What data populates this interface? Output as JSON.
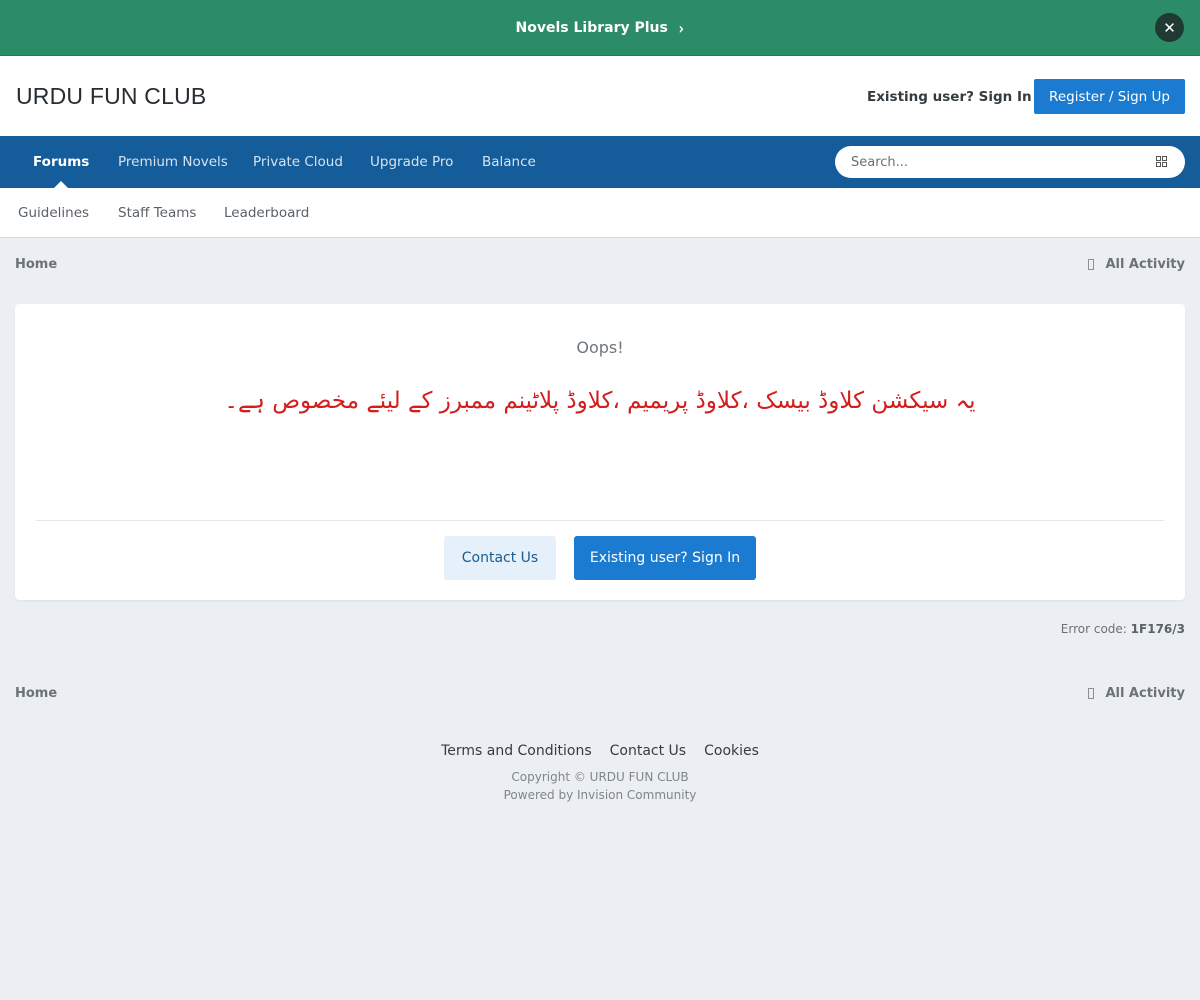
{
  "announcement": {
    "text": "Novels Library Plus",
    "chevron": "›",
    "close": "✕",
    "background": "#2c8c67"
  },
  "header": {
    "site_title": "URDU FUN CLUB",
    "signin_label": "Existing user? Sign In",
    "register_label": "Register / Sign Up",
    "accent": "#1a7bd0"
  },
  "primary_nav": {
    "items": [
      {
        "label": "Forums",
        "active": true
      },
      {
        "label": "Premium Novels"
      },
      {
        "label": "Private Cloud"
      },
      {
        "label": "Upgrade Pro"
      },
      {
        "label": "Balance"
      }
    ],
    "background": "#145c9a",
    "search_placeholder": "Search..."
  },
  "secondary_nav": {
    "items": [
      {
        "label": "Guidelines"
      },
      {
        "label": "Staff Teams"
      },
      {
        "label": "Leaderboard"
      }
    ]
  },
  "breadcrumb": {
    "home": "Home",
    "all_activity": "All Activity"
  },
  "error": {
    "title": "Oops!",
    "message": "یہ سیکشن  کلاوڈ بیسک ،کلاوڈ پریمیم ،کلاوڈ پلاٹینم ممبرز کے لیئے مخصوص ہے۔",
    "contact_label": "Contact Us",
    "signin_label": "Existing user? Sign In",
    "code_label": "Error code:",
    "code_value": "1F176/3",
    "message_color": "#d41d1d"
  },
  "footer": {
    "links": [
      "Terms and Conditions",
      "Contact Us",
      "Cookies"
    ],
    "copyright": "Copyright © URDU FUN CLUB",
    "powered_by": "Powered by Invision Community"
  }
}
